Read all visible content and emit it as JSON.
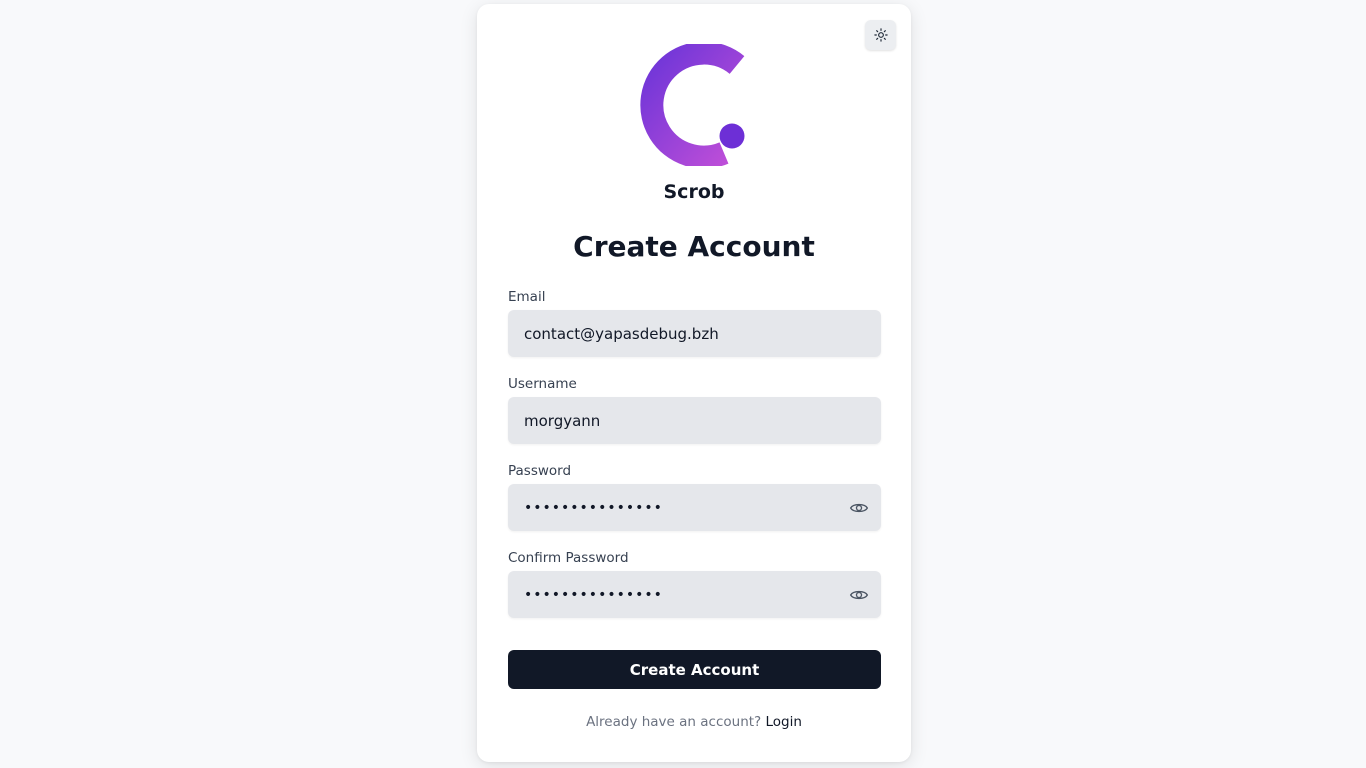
{
  "app": {
    "brand_name": "Scrob",
    "logo_icon": "scrob-logo-icon",
    "accent_gradient": [
      "#6d35d8",
      "#b84ad6"
    ]
  },
  "header": {
    "theme_toggle_icon": "sun-icon"
  },
  "form": {
    "title": "Create Account",
    "email": {
      "label": "Email",
      "value": "contact@yapasdebug.bzh"
    },
    "username": {
      "label": "Username",
      "value": "morgyann"
    },
    "password": {
      "label": "Password",
      "value": "•••••••••••••••",
      "toggle_icon": "eye-icon"
    },
    "confirm_password": {
      "label": "Confirm Password",
      "value": "•••••••••••••••",
      "toggle_icon": "eye-icon"
    },
    "submit_label": "Create Account"
  },
  "footer": {
    "prompt": "Already have an account?",
    "login_label": "Login"
  }
}
